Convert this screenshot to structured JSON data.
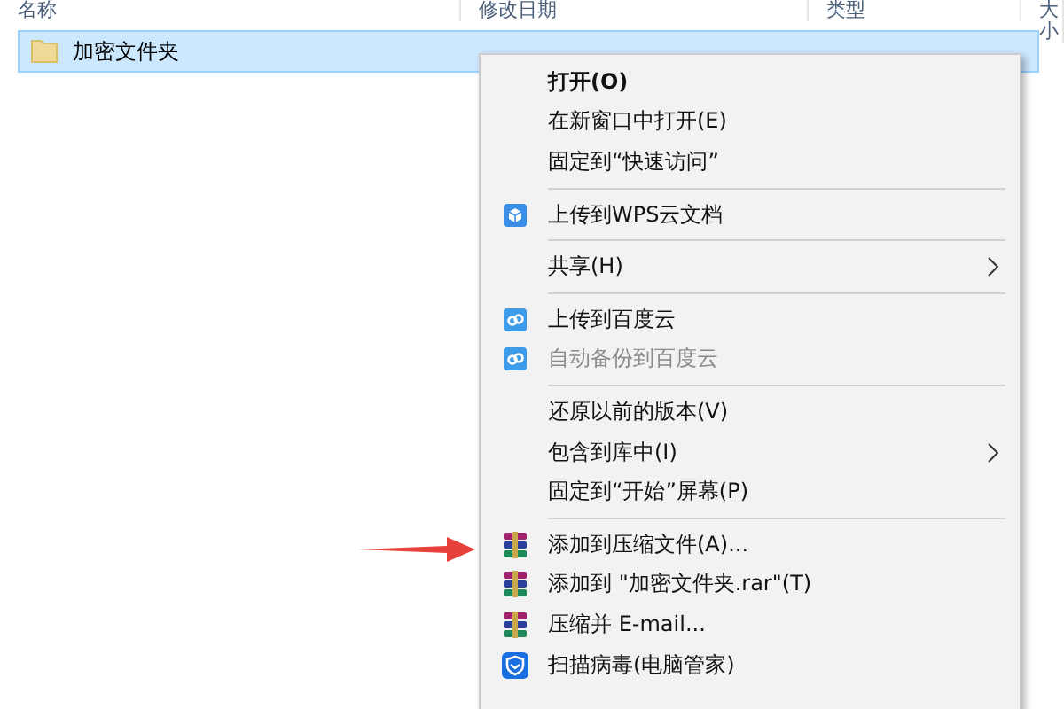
{
  "columns": [
    "名称",
    "修改日期",
    "类型",
    "大小"
  ],
  "rows": [
    {
      "name": "加密文件夹",
      "selected": true
    }
  ],
  "context_menu": {
    "items": [
      {
        "kind": "plain",
        "label": "打开(O)",
        "bold": true,
        "disabled": false,
        "submenu": false
      },
      {
        "kind": "plain",
        "label": "在新窗口中打开(E)",
        "bold": false,
        "disabled": false,
        "submenu": false
      },
      {
        "kind": "plain",
        "label": "固定到“快速访问”",
        "bold": false,
        "disabled": false,
        "submenu": false
      },
      {
        "kind": "separator"
      },
      {
        "kind": "wps",
        "label": "上传到WPS云文档",
        "bold": false,
        "disabled": false,
        "submenu": false
      },
      {
        "kind": "separator"
      },
      {
        "kind": "plain",
        "label": "共享(H)",
        "bold": false,
        "disabled": false,
        "submenu": true
      },
      {
        "kind": "separator"
      },
      {
        "kind": "baidu",
        "label": "上传到百度云",
        "bold": false,
        "disabled": false,
        "submenu": false
      },
      {
        "kind": "baidu",
        "label": "自动备份到百度云",
        "bold": false,
        "disabled": true,
        "submenu": false
      },
      {
        "kind": "separator"
      },
      {
        "kind": "plain",
        "label": "还原以前的版本(V)",
        "bold": false,
        "disabled": false,
        "submenu": false
      },
      {
        "kind": "plain",
        "label": "包含到库中(I)",
        "bold": false,
        "disabled": false,
        "submenu": true
      },
      {
        "kind": "plain",
        "label": "固定到“开始”屏幕(P)",
        "bold": false,
        "disabled": false,
        "submenu": false
      },
      {
        "kind": "separator"
      },
      {
        "kind": "winrar",
        "label": "添加到压缩文件(A)...",
        "bold": false,
        "disabled": false,
        "submenu": false
      },
      {
        "kind": "winrar",
        "label": "添加到 \"加密文件夹.rar\"(T)",
        "bold": false,
        "disabled": false,
        "submenu": false
      },
      {
        "kind": "winrar",
        "label": "压缩并 E-mail...",
        "bold": false,
        "disabled": false,
        "submenu": false
      },
      {
        "kind": "shield",
        "label": "扫描病毒(电脑管家)",
        "bold": false,
        "disabled": false,
        "submenu": false
      }
    ]
  }
}
